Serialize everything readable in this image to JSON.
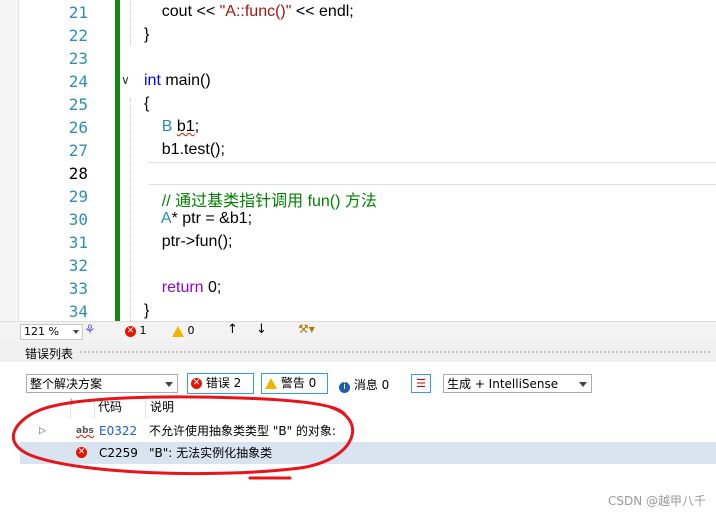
{
  "editor": {
    "lines": [
      {
        "num": "21",
        "text": "    cout << \"A::func()\" << endl;"
      },
      {
        "num": "22",
        "text": "}"
      },
      {
        "num": "23",
        "text": ""
      },
      {
        "num": "24",
        "text": "int main()"
      },
      {
        "num": "25",
        "text": "{"
      },
      {
        "num": "26",
        "text": "    B b1;"
      },
      {
        "num": "27",
        "text": "    b1.test();"
      },
      {
        "num": "28",
        "text": ""
      },
      {
        "num": "29",
        "text": "    // 通过基类指针调用 fun() 方法"
      },
      {
        "num": "30",
        "text": "    A* ptr = &b1;"
      },
      {
        "num": "31",
        "text": "    ptr->fun();"
      },
      {
        "num": "32",
        "text": ""
      },
      {
        "num": "33",
        "text": "    return 0;"
      },
      {
        "num": "34",
        "text": "}"
      }
    ]
  },
  "statusbar": {
    "zoom": "121 %",
    "error_count": "1",
    "warning_count": "0"
  },
  "error_list": {
    "title": "错误列表",
    "scope": "整个解决方案",
    "errors_btn": "错误 2",
    "warnings_btn": "警告 0",
    "messages_btn": "消息 0",
    "build_filter": "生成 + IntelliSense",
    "columns": {
      "code": "代码",
      "desc": "说明"
    },
    "rows": [
      {
        "code": "E0322",
        "desc": "不允许使用抽象类类型 \"B\" 的对象:",
        "abs_tag": "abs"
      },
      {
        "code": "C2259",
        "desc": "\"B\": 无法实例化抽象类"
      }
    ]
  },
  "watermark": "CSDN @越甲八千",
  "colors": {
    "change_bar": "#108a10",
    "error": "#e51400",
    "annotation": "#e8141a",
    "selected_row": "#d8e4f0"
  }
}
